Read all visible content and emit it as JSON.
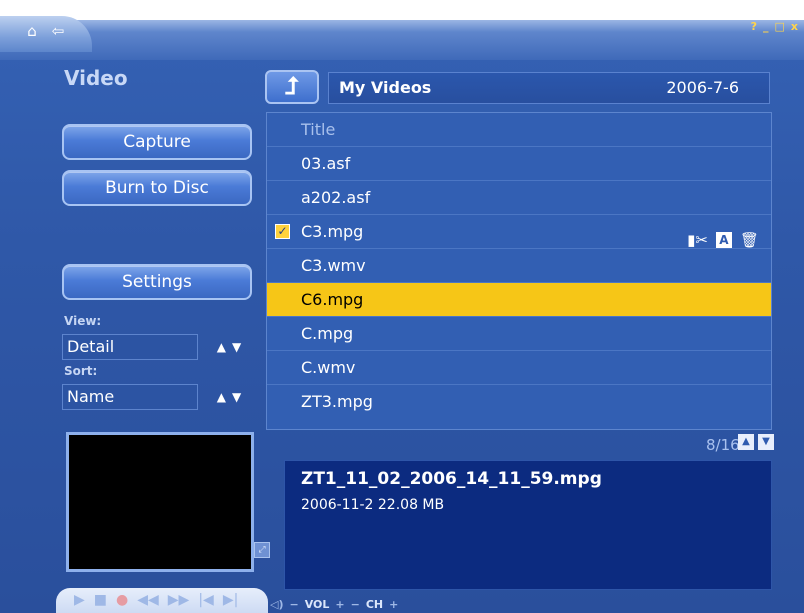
{
  "window": {
    "controls": [
      "?",
      "_",
      "□",
      "x"
    ]
  },
  "nav": {
    "home_icon": "house-icon",
    "back_icon": "back-arrow-icon"
  },
  "title": "Video",
  "left": {
    "capture_label": "Capture",
    "burn_label": "Burn to Disc",
    "settings_label": "Settings",
    "view_label": "View:",
    "view_value": "Detail",
    "sort_label": "Sort:",
    "sort_value": "Name"
  },
  "path": {
    "folder": "My Videos",
    "date": "2006-7-6"
  },
  "list": {
    "header": "Title",
    "items": [
      "03.asf",
      "a202.asf",
      "C3.mpg",
      "C3.wmv",
      "C6.mpg",
      "C.mpg",
      "C.wmv",
      "ZT3.mpg"
    ]
  },
  "pager": {
    "text": "8/16"
  },
  "info": {
    "filename": "ZT1_11_02_2006_14_11_59.mpg",
    "meta": "2006-11-2  22.08 MB"
  },
  "playback": {
    "vol_label": "VOL",
    "ch_label": "CH"
  },
  "colors": {
    "selection": "#f6c617",
    "background": "#3562b5",
    "info_panel": "#0c2b80"
  }
}
